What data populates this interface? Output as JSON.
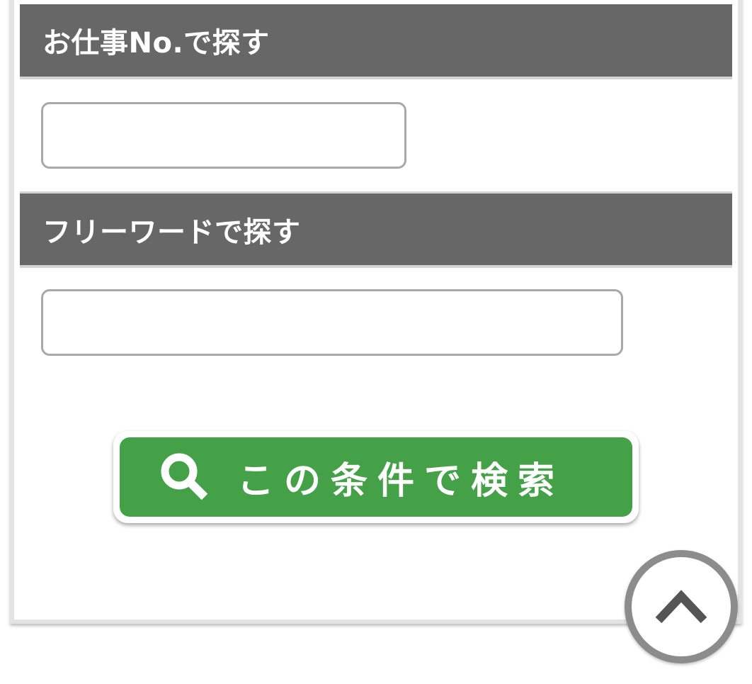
{
  "job_number_section": {
    "heading": "お仕事No.で探す",
    "input_value": "",
    "input_placeholder": ""
  },
  "free_word_section": {
    "heading": "フリーワードで探す",
    "input_value": "",
    "input_placeholder": ""
  },
  "search_button": {
    "label": "この条件で検索",
    "icon": "search-icon",
    "color": "#44a147"
  },
  "scroll_top_button": {
    "icon": "chevron-up-icon"
  },
  "colors": {
    "header_bg": "#676767",
    "accent_green": "#44a147",
    "input_border": "#a9a9a9"
  }
}
